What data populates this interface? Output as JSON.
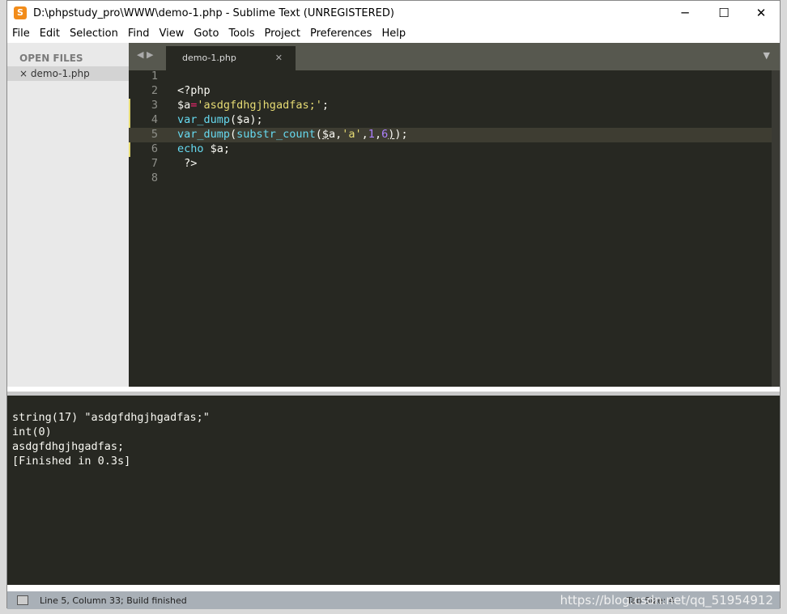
{
  "window": {
    "title": "D:\\phpstudy_pro\\WWW\\demo-1.php - Sublime Text (UNREGISTERED)"
  },
  "menu": [
    "File",
    "Edit",
    "Selection",
    "Find",
    "View",
    "Goto",
    "Tools",
    "Project",
    "Preferences",
    "Help"
  ],
  "sidebar": {
    "header": "OPEN FILES",
    "files": [
      "demo-1.php"
    ]
  },
  "tab": {
    "label": "demo-1.php"
  },
  "code": {
    "line_numbers": [
      "1",
      "2",
      "3",
      "4",
      "5",
      "6",
      "7",
      "8"
    ]
  },
  "output": {
    "lines": [
      "string(17) \"asdgfdhgjhgadfas;\"",
      "int(0)",
      "asdgfdhgjhgadfas;",
      "[Finished in 0.3s]"
    ]
  },
  "status": {
    "text": "Line 5, Column 33; Build finished",
    "tab_size": "Tab Size: 4",
    "watermark": "https://blog.csdn.net/qq_51954912"
  },
  "colors": {
    "editor_bg": "#272822",
    "keyword": "#66d9ef",
    "string": "#e6db74",
    "number": "#ae81ff"
  }
}
